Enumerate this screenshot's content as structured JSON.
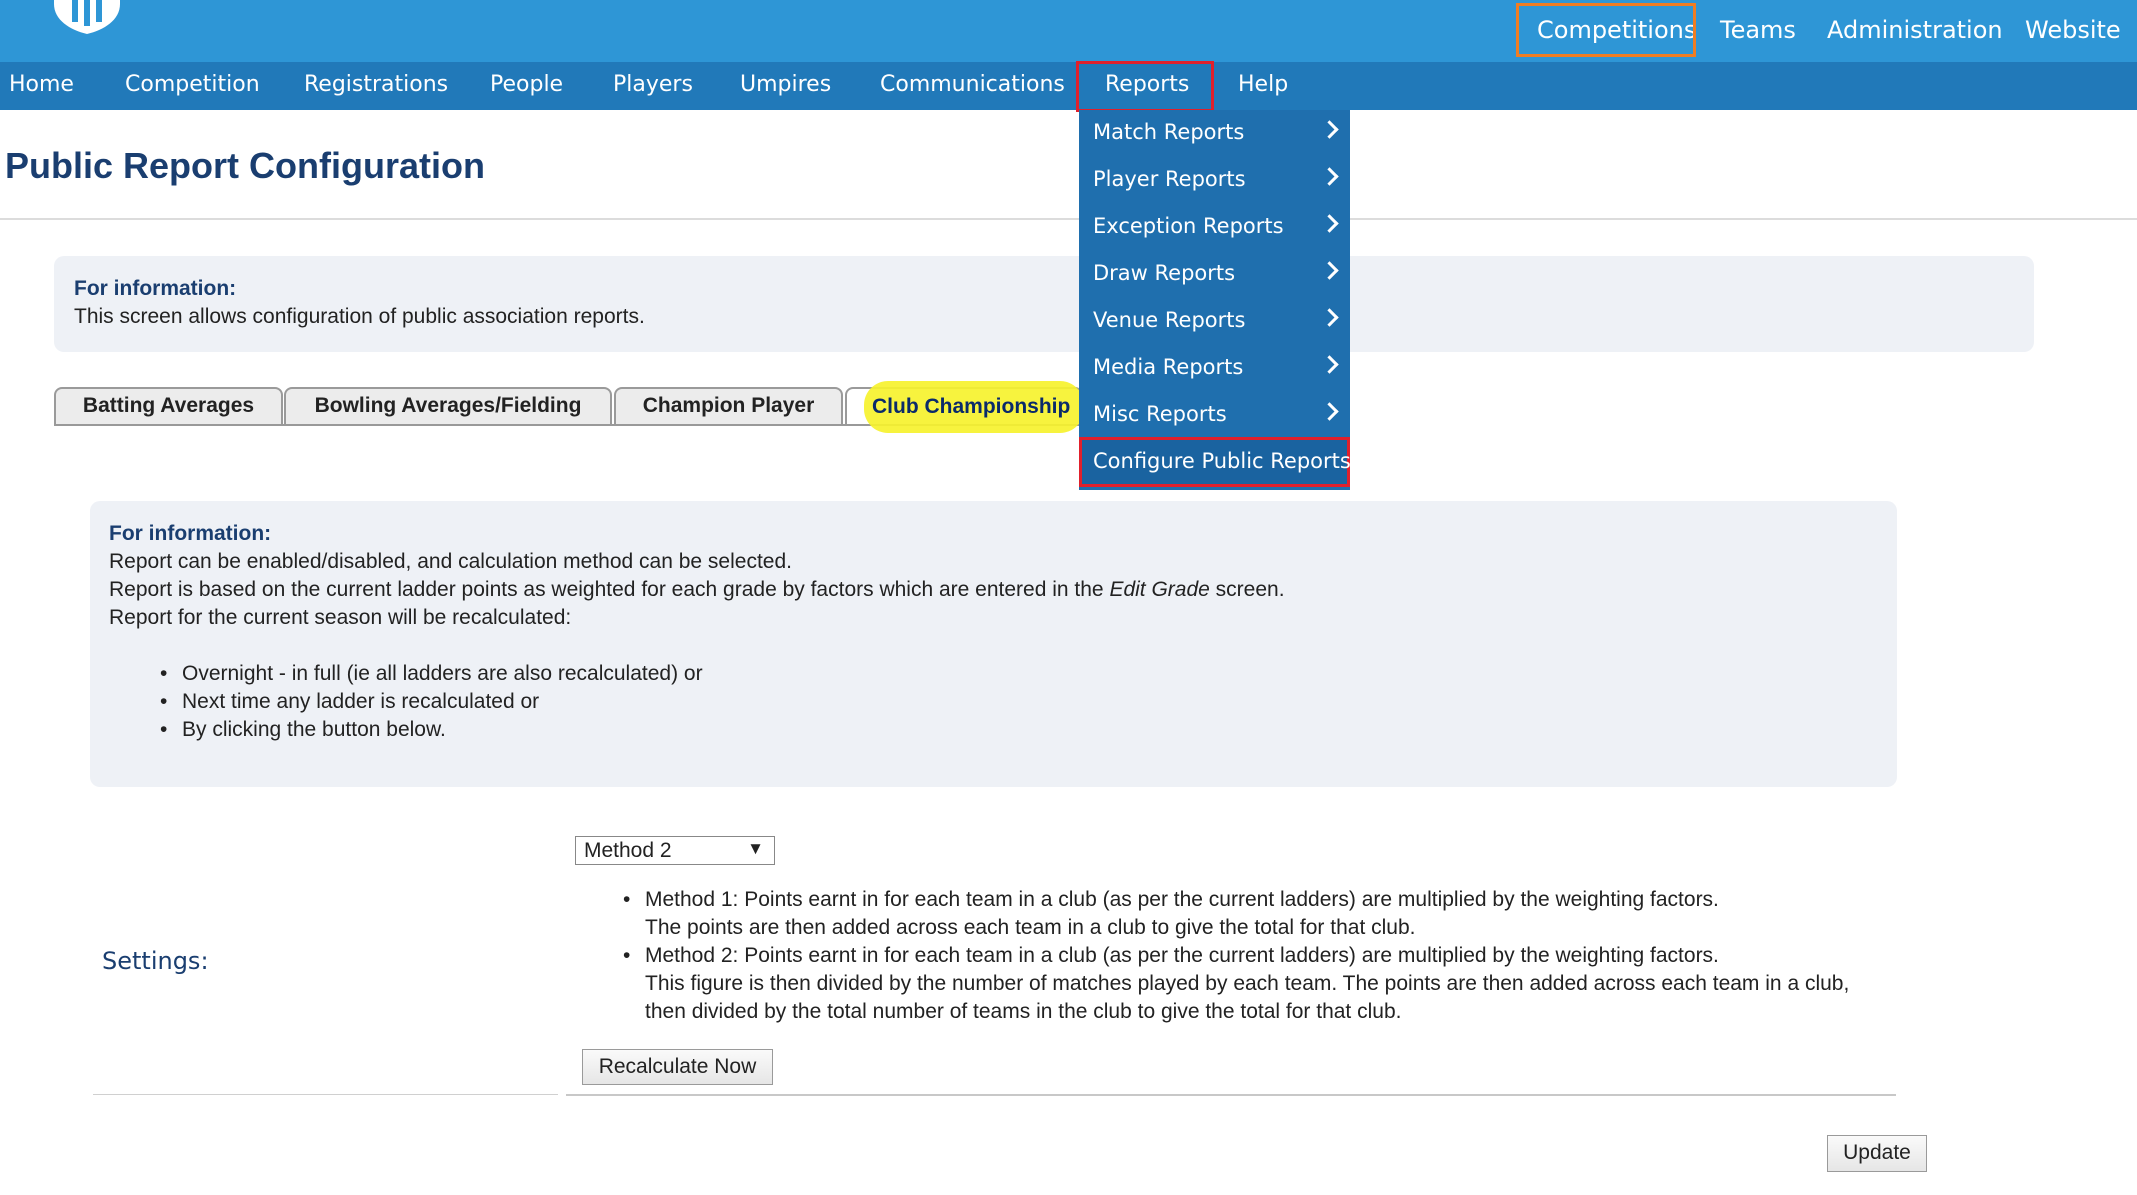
{
  "topbar": {
    "links": [
      "Competitions",
      "Teams",
      "Administration",
      "Website"
    ]
  },
  "nav": {
    "items": [
      "Home",
      "Competition",
      "Registrations",
      "People",
      "Players",
      "Umpires",
      "Communications",
      "Reports",
      "Help"
    ]
  },
  "reports_menu": {
    "items": [
      "Match Reports",
      "Player Reports",
      "Exception Reports",
      "Draw Reports",
      "Venue Reports",
      "Media Reports",
      "Misc Reports"
    ],
    "configure": "Configure Public Reports"
  },
  "page": {
    "title": "Public Report Configuration"
  },
  "info_top": {
    "heading": "For information:",
    "text": "This screen allows configuration of public association reports."
  },
  "tabs": [
    "Batting Averages",
    "Bowling Averages/Fielding",
    "Champion Player",
    "Club Championship"
  ],
  "info_club": {
    "heading": "For information:",
    "line1": "Report can be enabled/disabled, and calculation method can be selected.",
    "line2_pre": "Report is based on the current ladder points as weighted for each grade by factors which are entered in the ",
    "line2_em": "Edit Grade",
    "line2_post": " screen.",
    "line3": "Report for the current season will be recalculated:",
    "bullets": [
      "Overnight - in full (ie all ladders are also recalculated) or",
      "Next time any ladder is recalculated or",
      "By clicking the button below."
    ]
  },
  "settings": {
    "label": "Settings:",
    "method_selected": "Method 2",
    "method1_line1": "Method 1: Points earnt in for each team in a club (as per the current ladders) are multiplied by the weighting factors.",
    "method1_line2": "The points are then added across each team in a club to give the total for that club.",
    "method2_line1": "Method 2: Points earnt in for each team in a club (as per the current ladders) are multiplied by the weighting factors.",
    "method2_line2": "This figure is then divided by the number of matches played by each team. The points are then added across each team in a club,",
    "method2_line3": "then divided by the total number of teams in the club to give the total for that club.",
    "recalc_label": "Recalculate Now",
    "update_label": "Update"
  },
  "colors": {
    "topbar": "#2e96d6",
    "navbar": "#2179b9",
    "dropdown": "#1f6fae",
    "highlight_red": "#e0202c",
    "highlight_orange": "#ef7d22",
    "highlight_yellow": "#f6f22e"
  }
}
